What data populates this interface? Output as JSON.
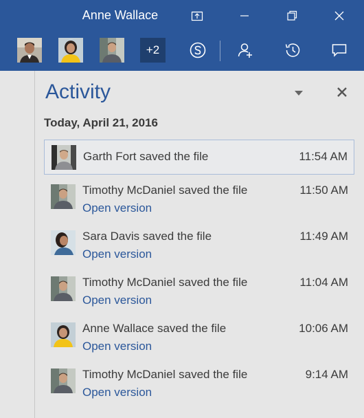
{
  "window": {
    "title": "Anne Wallace"
  },
  "toolbar": {
    "extra_count": "+2",
    "icons": [
      "share-icon",
      "minimize-icon",
      "restore-icon",
      "close-icon",
      "skype-icon",
      "add-person-icon",
      "history-icon",
      "comment-icon"
    ]
  },
  "colors": {
    "titlebar": "#2b579a",
    "accent": "#2b579a",
    "panel_background": "#e6e6e6"
  },
  "activity": {
    "title": "Activity",
    "date_header": "Today, April 21, 2016",
    "items": [
      {
        "text": "Garth Fort saved the file",
        "time": "11:54 AM",
        "link": ""
      },
      {
        "text": "Timothy McDaniel saved the file",
        "time": "11:50 AM",
        "link": "Open version"
      },
      {
        "text": "Sara Davis saved the file",
        "time": "11:49 AM",
        "link": "Open version"
      },
      {
        "text": "Timothy McDaniel saved the file",
        "time": "11:04 AM",
        "link": "Open version"
      },
      {
        "text": "Anne Wallace saved the file",
        "time": "10:06 AM",
        "link": "Open version"
      },
      {
        "text": "Timothy McDaniel saved the file",
        "time": "9:14 AM",
        "link": "Open version"
      }
    ]
  }
}
